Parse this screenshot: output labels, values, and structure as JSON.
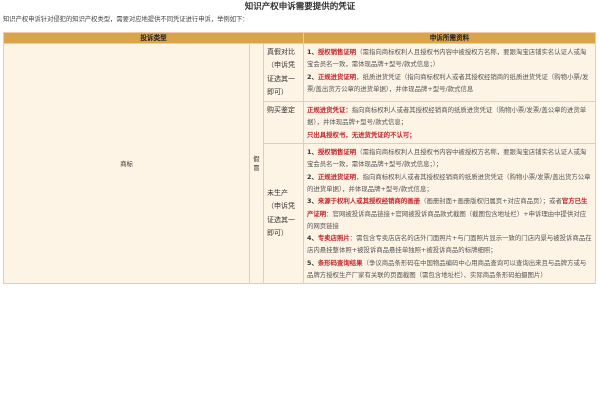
{
  "title": "知识产权申诉需要提供的凭证",
  "intro": "知识产权申诉针对侵犯的知识产权类型，需要对应地提供不同凭证进行申诉，举例如下：",
  "header": {
    "type": "投诉类型",
    "materials": "申诉所需资料"
  },
  "category": "商标",
  "fake_label": "假冒",
  "rows": [
    {
      "sub": "真假对比（申诉凭证选其一即可）",
      "items": [
        {
          "num": "1、",
          "bold": "授权销售证明",
          "text": "（需指向商标权利人且授权书内容中被授权方名称，要跟淘宝店铺实名认证人或淘宝会员名一致，需体现品牌+型号/款式信息；）"
        },
        {
          "num": "2、",
          "bold": "正规进货证明",
          "text": "，纸质进货凭证（指向商标权利人或者其授权经销商的纸质进货凭证（购物小票/发票/盖出货方公章的进货单据），并体现品牌+型号/款式信息"
        }
      ]
    },
    {
      "sub": "购买鉴定",
      "line1_bold": "正规进货凭证：",
      "line1_text": "指向商标权利人或者其授权经销商的纸质进货凭证（购物小票/发票/盖公章的进货单据），并体现品牌+型号/款式信息；",
      "line2": "只出具授权书，无进货凭证的不认可；"
    },
    {
      "sub": "未生产（申诉凭证选其一即可）",
      "items": [
        {
          "num": "1、",
          "bold": "授权销售证明",
          "text": "（需指向商标权利人且授权书内容中被授权方名称，要跟淘宝店铺实名认证人或淘宝会员名一致，需体现品牌+型号/款式信息；）；"
        },
        {
          "num": "2、",
          "bold": "正规进货证明",
          "text": "，指向商标权利人或者其授权经销商的纸质进货凭证（购物小票/发票/盖出货方公章的进货单据），并体现品牌+型号/款式信息；"
        },
        {
          "num": "3、",
          "bold": "来源于权利人或其授权经销商的画册",
          "text": "（画册封面+画册版权归属页+对应商品页）；或者",
          "bold2": "官方已生产证明",
          "text2": "：官网被投诉商品链接+官网被投诉商品款式截图（截图包含地址栏）+申诉理由中提供对应的网页链接"
        },
        {
          "num": "4、",
          "bold": "专卖店照片",
          "text": "：需包含专卖店店名的店外门面照片+与门面照片显示一致的门店内景与被投诉商品在店内悬挂整体照+被投诉商品悬挂单独照+被投诉商品的标牌细照；"
        },
        {
          "num": "5、",
          "bold": "条形码查询结果",
          "text": "（争议商品条形码在中国物品编码中心用商品查询可以查询出来且与品牌方或与品牌方授权生产厂家有关联的页面截图（需包含地址栏）、实际商品条形码拍摄图片）"
        }
      ]
    }
  ],
  "colors": {
    "header_bg": "#d9a44a",
    "cell_bg": "#fdf4e6",
    "border": "#f2c9a0",
    "highlight": "#c1272d"
  }
}
